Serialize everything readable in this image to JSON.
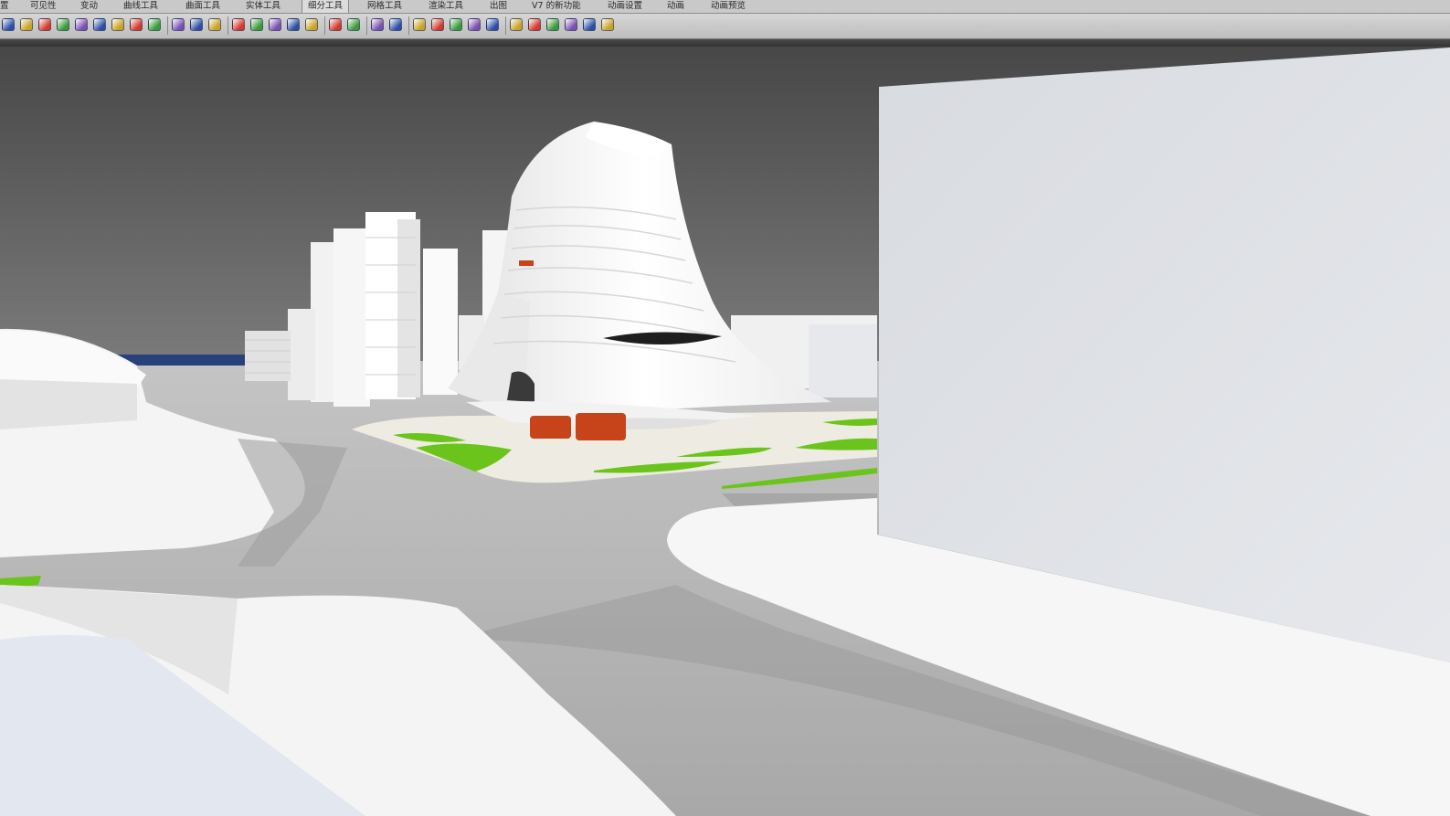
{
  "menu_tabs": [
    {
      "label": "置",
      "active": false
    },
    {
      "label": "可见性",
      "active": false
    },
    {
      "label": "变动",
      "active": false
    },
    {
      "label": "曲线工具",
      "active": false
    },
    {
      "label": "曲面工具",
      "active": false
    },
    {
      "label": "实体工具",
      "active": false
    },
    {
      "label": "细分工具",
      "active": true
    },
    {
      "label": "网格工具",
      "active": false
    },
    {
      "label": "渲染工具",
      "active": false
    },
    {
      "label": "出图",
      "active": false
    },
    {
      "label": "V7 的新功能",
      "active": false
    },
    {
      "label": "动画设置",
      "active": false
    },
    {
      "label": "动画",
      "active": false
    },
    {
      "label": "动画预览",
      "active": false
    }
  ],
  "toolbar": {
    "icons": [
      "subd-curve-icon",
      "subd-box-icon",
      "subd-cube-icon",
      "subd-chain-icon",
      "subd-grid-icon",
      "subd-link-icon",
      "subd-panel-icon",
      "subd-sphere-icon",
      "subd-frame-icon",
      "subd-cylinder-icon",
      "subd-bridge-icon",
      "subd-torus-icon",
      "subd-crease-icon",
      "subd-wedge-icon",
      "subd-blob-icon",
      "subd-stack-icon",
      "subd-bowl-icon",
      "mesh-grid-icon",
      "list-icon",
      "tools-icon",
      "gear-icon",
      "gold-cube-icon",
      "pencil-icon",
      "globe-icon",
      "yellow-tool-icon",
      "brush-icon",
      "sphere-outline-icon",
      "gold-sphere-icon",
      "light-blue-icon",
      "red-no-icon",
      "node-icon",
      "camera-icon"
    ],
    "colors": [
      "#2d4fa3",
      "#c9a227",
      "#d23a2a",
      "#3a9a3a",
      "#7a4fb0"
    ]
  },
  "scene": {
    "sky_top": "#505050",
    "sky_bottom": "#7c7c7c",
    "ground": "#bdbdbd",
    "lawn": "#6bc41b",
    "building_white": "#f4f4f4",
    "building_shadow": "#d2d2d2",
    "pillar_orange": "#c7441a",
    "water": "#27417a"
  }
}
